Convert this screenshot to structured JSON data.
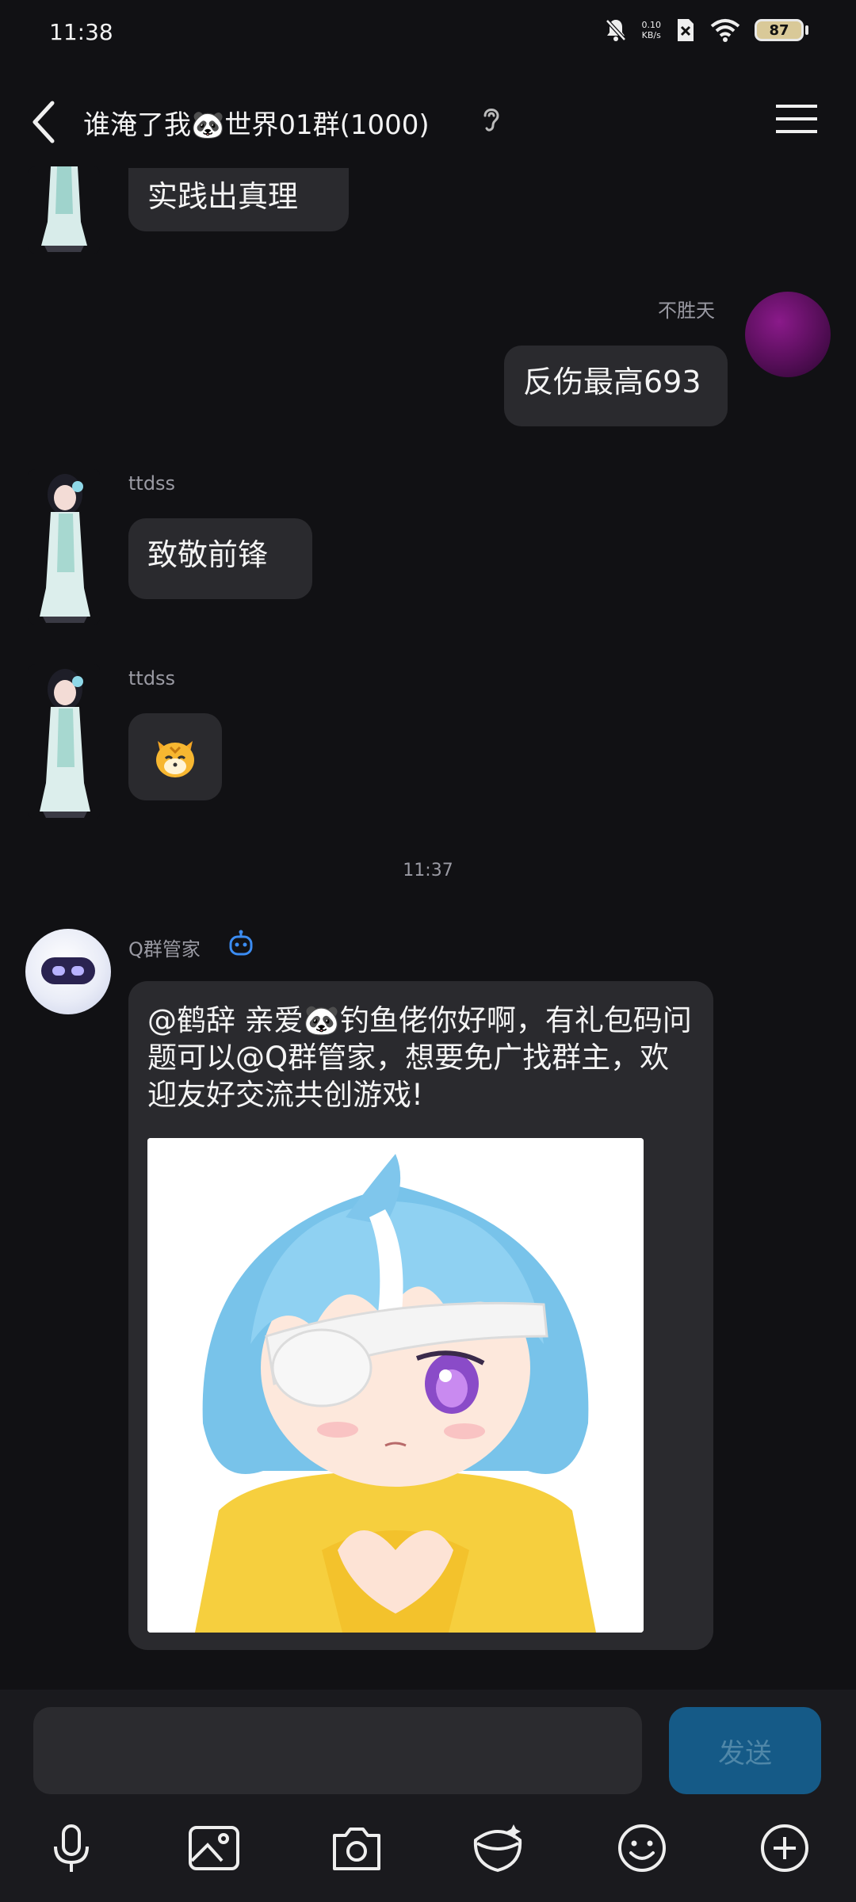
{
  "status_bar": {
    "time": "11:38",
    "net_speed": "0.10",
    "net_unit": "KB/s",
    "battery": "87"
  },
  "header": {
    "title": "谁淹了我🐼世界01群(1000)"
  },
  "messages": [
    {
      "sender": "",
      "text": "实践出真理"
    },
    {
      "sender": "不胜天",
      "text": "反伤最高693"
    },
    {
      "sender": "ttdss",
      "text": "致敬前锋"
    },
    {
      "sender": "ttdss",
      "text": "🐯"
    }
  ],
  "time_separator": "11:37",
  "bot_message": {
    "sender": "Q群管家",
    "text": "@鹤辞 亲爱🐼钓鱼佬你好啊，有礼包码问题可以@Q群管家，想要免广找群主，欢迎友好交流共创游戏!"
  },
  "input": {
    "placeholder": "",
    "send_label": "发送"
  },
  "colors": {
    "background": "#111114",
    "bubble": "#2a2a2e",
    "send_button": "#155a87",
    "bot_icon_accent": "#3b8cf2"
  },
  "toolbar_icons": [
    "microphone-icon",
    "image-icon",
    "camera-icon",
    "red-packet-icon",
    "emoji-icon",
    "plus-icon"
  ]
}
